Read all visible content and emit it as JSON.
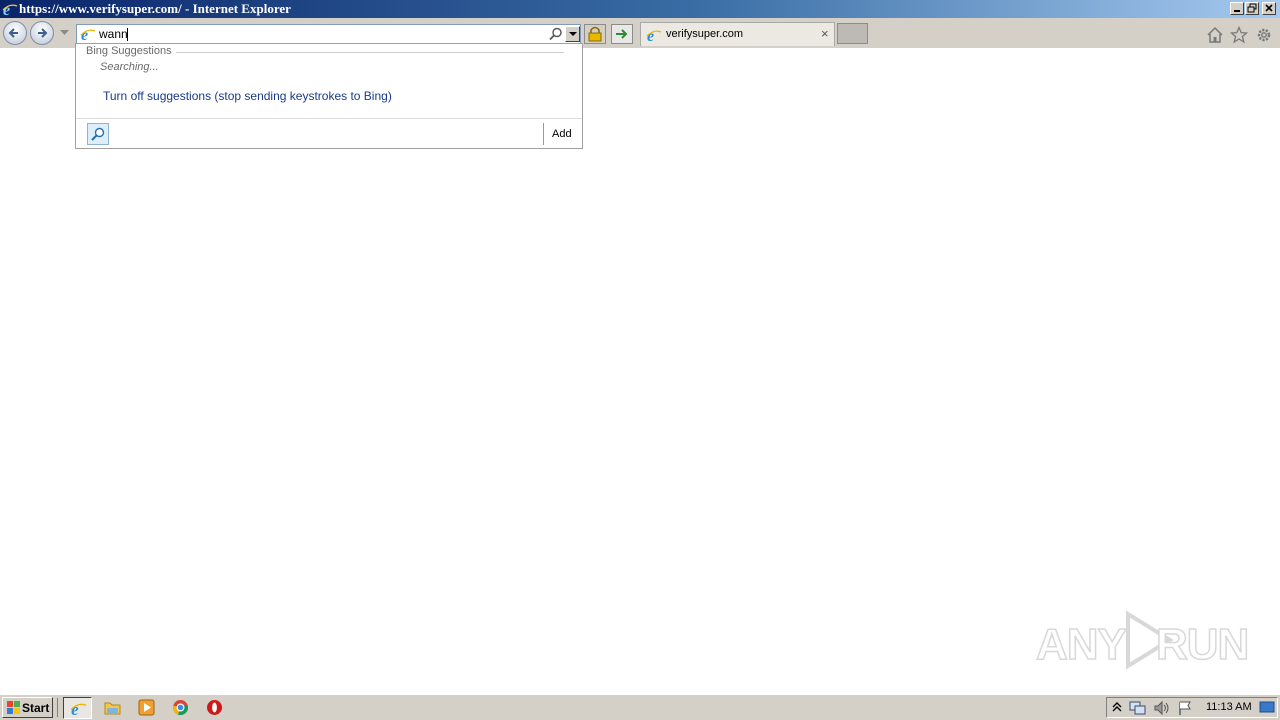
{
  "window": {
    "title": "https://www.verifysuper.com/ - Internet Explorer",
    "controls": [
      "minimize",
      "restore",
      "close"
    ]
  },
  "toolbar": {
    "address_value": "wann",
    "tab_label": "verifysuper.com",
    "tab_close": "×",
    "icons": [
      "back-icon",
      "forward-icon",
      "lock-icon",
      "go-arrow-icon",
      "home-icon",
      "favorites-star-icon",
      "tools-gear-icon"
    ]
  },
  "suggestions": {
    "heading": "Bing Suggestions",
    "status": "Searching...",
    "turn_off": "Turn off suggestions (stop sending keystrokes to Bing)",
    "add_label": "Add"
  },
  "watermark": {
    "left": "ANY",
    "right": "RUN"
  },
  "taskbar": {
    "start_label": "Start",
    "pinned": [
      "internet-explorer",
      "file-explorer",
      "media-player",
      "chrome",
      "opera"
    ],
    "clock": "11:13 AM"
  },
  "colors": {
    "titlebar_start": "#0a246a",
    "titlebar_end": "#a6caf0",
    "chrome_gray": "#d4d0c8",
    "link_blue": "#1a3a8a"
  }
}
